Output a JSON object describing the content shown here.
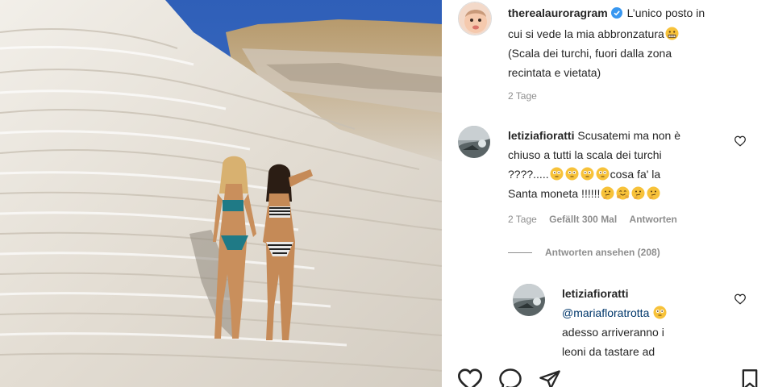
{
  "post": {
    "author": "therealauroragram",
    "verified": true,
    "caption_lines": [
      "L’unico posto in",
      "cui si vede la mia abbronzatura",
      "(Scala dei turchi, fuori dalla zona",
      "recintata e vietata)"
    ],
    "time": "2 Tage"
  },
  "comments": [
    {
      "user": "letiziafioratti",
      "lines": [
        "Scusatemi ma non è",
        "chiuso a tutti la scala dei turchi",
        "????.....",
        "cosa fa' la",
        "Santa moneta !!!!!!"
      ],
      "time": "2 Tage",
      "likes": "Gefällt 300 Mal",
      "reply": "Antworten",
      "view_replies": "Antworten ansehen (208)"
    },
    {
      "user": "letiziafioratti",
      "mention": "@mariafloratrotta",
      "lines": [
        "adesso arriveranno i",
        "leoni da tastare ad"
      ]
    }
  ],
  "icons": {
    "verified": "verified-badge-icon",
    "like": "heart-icon",
    "comment": "comment-icon",
    "share": "paper-plane-icon",
    "save": "bookmark-icon",
    "emoji_grin": "grimacing-emoji",
    "emoji_flushed": "flushed-emoji",
    "emoji_think": "thinking-emoji",
    "emoji_hug": "hugging-emoji"
  },
  "colors": {
    "verified_blue": "#3897f0",
    "mention_blue": "#00376b",
    "meta_gray": "#8e8e8e",
    "emoji_yellow": "#f7c23a"
  }
}
